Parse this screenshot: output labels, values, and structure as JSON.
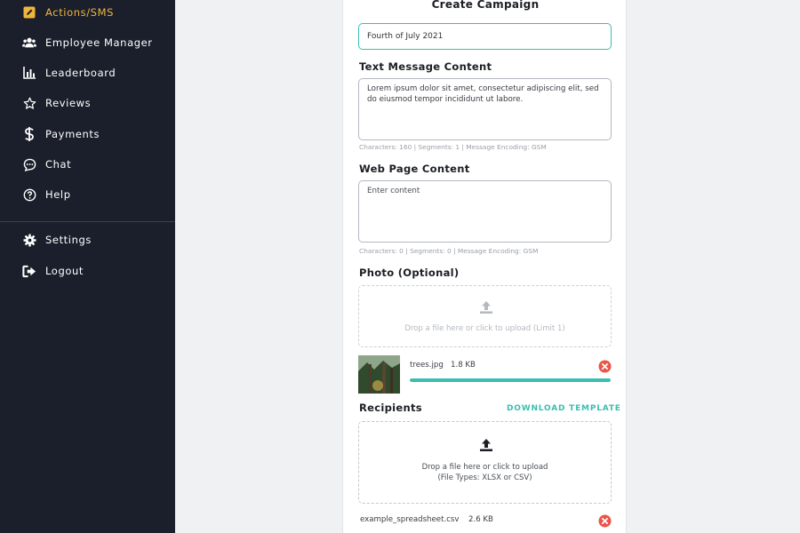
{
  "sidebar": {
    "items": [
      {
        "label": "Actions/SMS",
        "icon": "edit-square-icon",
        "active": true
      },
      {
        "label": "Employee Manager",
        "icon": "users-icon"
      },
      {
        "label": "Leaderboard",
        "icon": "bar-chart-icon"
      },
      {
        "label": "Reviews",
        "icon": "star-icon"
      },
      {
        "label": "Payments",
        "icon": "dollar-icon"
      },
      {
        "label": "Chat",
        "icon": "chat-bubble-icon"
      },
      {
        "label": "Help",
        "icon": "question-circle-icon"
      }
    ],
    "bottom_items": [
      {
        "label": "Settings",
        "icon": "gear-icon"
      },
      {
        "label": "Logout",
        "icon": "logout-icon"
      }
    ]
  },
  "form": {
    "title": "Create Campaign",
    "campaign_name": "Fourth of July 2021",
    "text_message": {
      "label": "Text Message Content",
      "value": "Lorem ipsum dolor sit amet, consectetur adipiscing elit, sed do eiusmod tempor incididunt ut labore.",
      "meta": "Characters: 160 | Segments: 1 | Message Encoding: GSM"
    },
    "web_page": {
      "label": "Web Page Content",
      "placeholder": "Enter content",
      "meta": "Characters: 0 | Segments: 0 | Message Encoding: GSM"
    },
    "photo": {
      "label": "Photo (Optional)",
      "dropzone_text": "Drop a file here or click to upload (Limit 1)",
      "file": {
        "name": "trees.jpg",
        "size": "1.8 KB",
        "progress": 1.0
      }
    },
    "recipients": {
      "label": "Recipients",
      "download_label": "DOWNLOAD TEMPLATE",
      "dropzone_line1": "Drop a file here or click to upload",
      "dropzone_line2": "(File Types: XLSX or CSV)",
      "file": {
        "name": "example_spreadsheet.csv",
        "size": "2.6 KB"
      }
    }
  },
  "colors": {
    "sidebar_bg": "#1a1f2b",
    "active": "#f1b53b",
    "accent": "#3bbdb0",
    "danger": "#e8574a"
  }
}
